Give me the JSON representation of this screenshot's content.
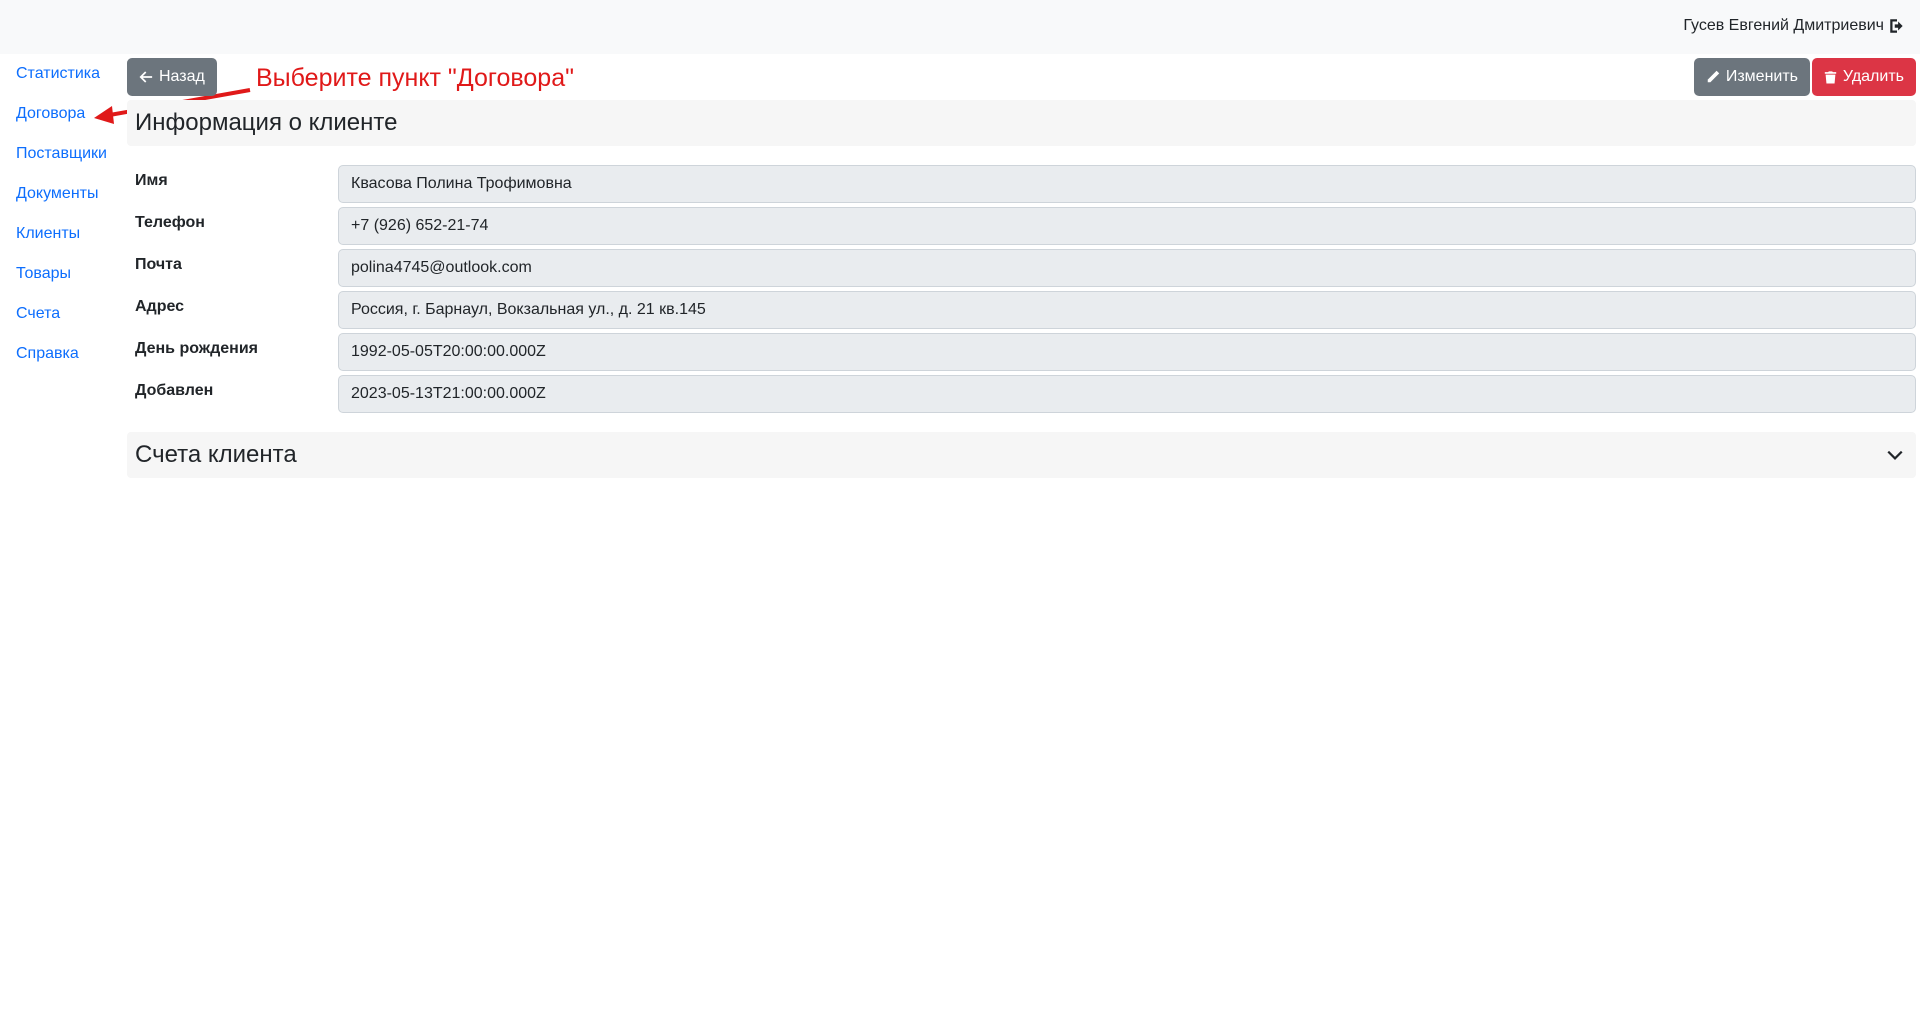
{
  "header": {
    "user_name": "Гусев Евгений Дмитриевич",
    "logout_icon": "sign-out-icon"
  },
  "sidebar": {
    "items": [
      {
        "label": "Статистика"
      },
      {
        "label": "Договора"
      },
      {
        "label": "Поставщики"
      },
      {
        "label": "Документы"
      },
      {
        "label": "Клиенты"
      },
      {
        "label": "Товары"
      },
      {
        "label": "Счета"
      },
      {
        "label": "Справка"
      }
    ]
  },
  "toolbar": {
    "back_label": "Назад",
    "edit_label": "Изменить",
    "delete_label": "Удалить"
  },
  "annotation": {
    "text": "Выберите пункт \"Договора\""
  },
  "client_info": {
    "title": "Информация о клиенте",
    "fields": [
      {
        "label": "Имя",
        "value": "Квасова Полина Трофимовна"
      },
      {
        "label": "Телефон",
        "value": "+7 (926) 652-21-74"
      },
      {
        "label": "Почта",
        "value": "polina4745@outlook.com"
      },
      {
        "label": "Адрес",
        "value": "Россия, г. Барнаул, Вокзальная ул., д. 21 кв.145"
      },
      {
        "label": "День рождения",
        "value": "1992-05-05T20:00:00.000Z"
      },
      {
        "label": "Добавлен",
        "value": "2023-05-13T21:00:00.000Z"
      }
    ]
  },
  "accounts": {
    "title": "Счета клиента"
  },
  "colors": {
    "link": "#0d6efd",
    "secondary_button": "#6c757d",
    "danger_button": "#dc3545",
    "annotation": "#e01919"
  }
}
